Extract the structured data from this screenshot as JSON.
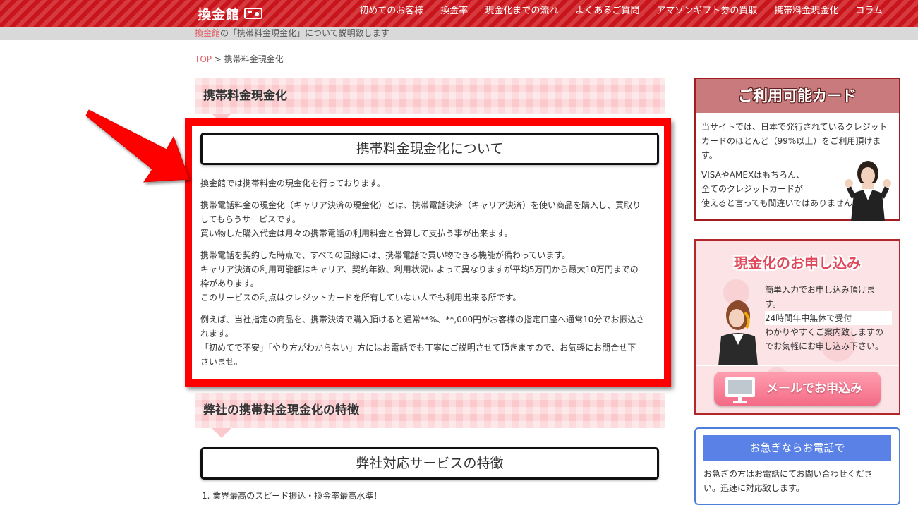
{
  "header": {
    "logo_text": "換金館",
    "nav": [
      "初めてのお客様",
      "換金率",
      "現金化までの流れ",
      "よくあるご質問",
      "アマゾンギフト券の買取",
      "携帯料金現金化",
      "コラム"
    ]
  },
  "subbar": {
    "brand": "換金館",
    "text": "の「携帯料金現金化」について説明致します"
  },
  "breadcrumb": {
    "top": "TOP",
    "sep": " > ",
    "current": "携帯料金現金化"
  },
  "section1": {
    "heading": "携帯料金現金化",
    "box_title": "携帯料金現金化について",
    "paragraphs": [
      [
        "換金館では携帯料金の現金化を行っております。"
      ],
      [
        "携帯電話料金の現金化（キャリア決済の現金化）とは、携帯電話決済（キャリア決済）を使い商品を購入し、買取り",
        "してもらうサービスです。",
        "買い物した購入代金は月々の携帯電話の利用料金と合算して支払う事が出来ます。"
      ],
      [
        "携帯電話を契約した時点で、すべての回線には、携帯電話で買い物できる機能が備わっています。",
        "キャリア決済の利用可能額はキャリア、契約年数、利用状況によって異なりますが平均5万円から最大10万円までの",
        "枠があります。",
        "このサービスの利点はクレジットカードを所有していない人でも利用出来る所です。"
      ],
      [
        "例えば、当社指定の商品を、携帯決済で購入頂けると通常**%、**,000円がお客様の指定口座へ通常10分でお振込さ",
        "れます。",
        "「初めてで不安」「やり方がわからない」方にはお電話でも丁寧にご説明させて頂きますので、お気軽にお問合せ下",
        "さいませ。"
      ]
    ]
  },
  "section2": {
    "heading": "弊社の携帯料金現金化の特徴",
    "box_title": "弊社対応サービスの特徴",
    "list_partial": "1. 業界最高のスピード振込・換金率最高水準！"
  },
  "sidebar": {
    "cards": {
      "title": "ご利用可能カード",
      "p1": [
        "当サイトでは、日本で発行されているクレジット",
        "カードのほとんど（99%以上）をご利用頂けま",
        "す。"
      ],
      "p2": [
        "VISAやAMEXはもちろん、",
        "全てのクレジットカードが",
        "使えると言っても間違いではありません。"
      ]
    },
    "apply": {
      "title": "現金化のお申し込み",
      "lines": [
        "簡単入力でお申し込み頂けま",
        "す。"
      ],
      "highlight": "24時間年中無休で受付",
      "lines2": [
        "わかりやすくご案内致しますの",
        "でお気軽にお申し込み下さい。"
      ],
      "button": "メールでお申込み"
    },
    "phone": {
      "title": "お急ぎならお電話で",
      "lines": [
        "お急ぎの方はお電話にてお問い合わせくださ",
        "い。迅速に対応致します。"
      ]
    }
  },
  "colors": {
    "header_red": "#c8151b",
    "accent_pink": "#e4606a",
    "highlight_red": "#ff0000",
    "section_pink": "#fbc8cc",
    "phone_blue": "#5a82e6"
  }
}
